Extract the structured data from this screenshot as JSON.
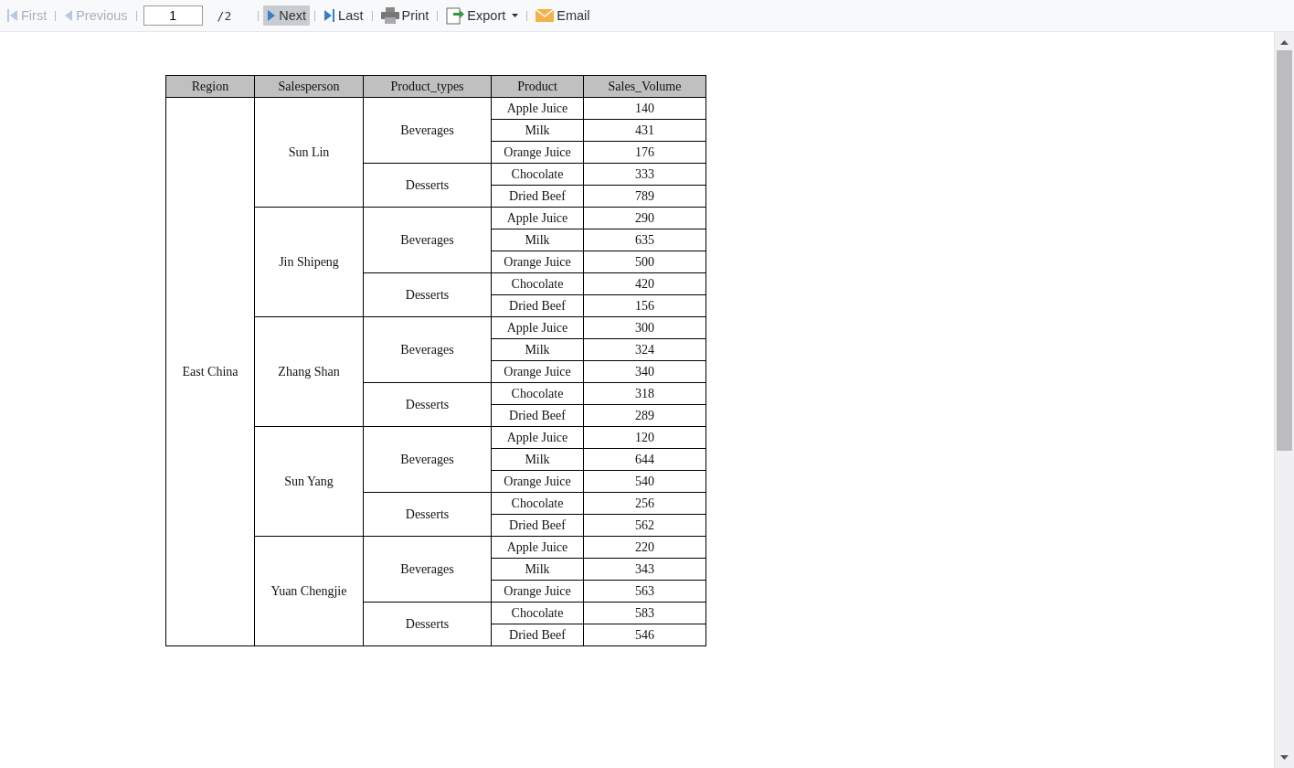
{
  "toolbar": {
    "items": [
      {
        "kind": "button",
        "label": "First",
        "disabled": true,
        "highlighted": false
      },
      {
        "kind": "button",
        "label": "Previous",
        "disabled": true,
        "highlighted": false
      },
      {
        "kind": "page",
        "value": "1",
        "total": "/2"
      },
      {
        "kind": "button",
        "label": "Next",
        "disabled": false,
        "highlighted": true
      },
      {
        "kind": "button",
        "label": "Last",
        "disabled": false,
        "highlighted": false
      },
      {
        "kind": "button",
        "label": "Print",
        "disabled": false,
        "highlighted": false
      },
      {
        "kind": "menu",
        "label": "Export",
        "disabled": false,
        "highlighted": false
      },
      {
        "kind": "button",
        "label": "Email",
        "disabled": false,
        "highlighted": false
      }
    ]
  },
  "table": {
    "columns": [
      "Region",
      "Salesperson",
      "Product_types",
      "Product",
      "Sales_Volume"
    ],
    "regions": [
      {
        "name": "East China",
        "salespeople": [
          {
            "name": "Sun Lin",
            "types": [
              {
                "name": "Beverages",
                "products": [
                  [
                    "Apple Juice",
                    "140"
                  ],
                  [
                    "Milk",
                    "431"
                  ],
                  [
                    "Orange Juice",
                    "176"
                  ]
                ]
              },
              {
                "name": "Desserts",
                "products": [
                  [
                    "Chocolate",
                    "333"
                  ],
                  [
                    "Dried Beef",
                    "789"
                  ]
                ]
              }
            ]
          },
          {
            "name": "Jin Shipeng",
            "types": [
              {
                "name": "Beverages",
                "products": [
                  [
                    "Apple Juice",
                    "290"
                  ],
                  [
                    "Milk",
                    "635"
                  ],
                  [
                    "Orange Juice",
                    "500"
                  ]
                ]
              },
              {
                "name": "Desserts",
                "products": [
                  [
                    "Chocolate",
                    "420"
                  ],
                  [
                    "Dried Beef",
                    "156"
                  ]
                ]
              }
            ]
          },
          {
            "name": "Zhang Shan",
            "types": [
              {
                "name": "Beverages",
                "products": [
                  [
                    "Apple Juice",
                    "300"
                  ],
                  [
                    "Milk",
                    "324"
                  ],
                  [
                    "Orange Juice",
                    "340"
                  ]
                ]
              },
              {
                "name": "Desserts",
                "products": [
                  [
                    "Chocolate",
                    "318"
                  ],
                  [
                    "Dried Beef",
                    "289"
                  ]
                ]
              }
            ]
          },
          {
            "name": "Sun Yang",
            "types": [
              {
                "name": "Beverages",
                "products": [
                  [
                    "Apple Juice",
                    "120"
                  ],
                  [
                    "Milk",
                    "644"
                  ],
                  [
                    "Orange Juice",
                    "540"
                  ]
                ]
              },
              {
                "name": "Desserts",
                "products": [
                  [
                    "Chocolate",
                    "256"
                  ],
                  [
                    "Dried Beef",
                    "562"
                  ]
                ]
              }
            ]
          },
          {
            "name": "Yuan Chengjie",
            "types": [
              {
                "name": "Beverages",
                "products": [
                  [
                    "Apple Juice",
                    "220"
                  ],
                  [
                    "Milk",
                    "343"
                  ],
                  [
                    "Orange Juice",
                    "563"
                  ]
                ]
              },
              {
                "name": "Desserts",
                "products": [
                  [
                    "Chocolate",
                    "583"
                  ],
                  [
                    "Dried Beef",
                    "546"
                  ]
                ]
              }
            ]
          }
        ]
      }
    ]
  }
}
